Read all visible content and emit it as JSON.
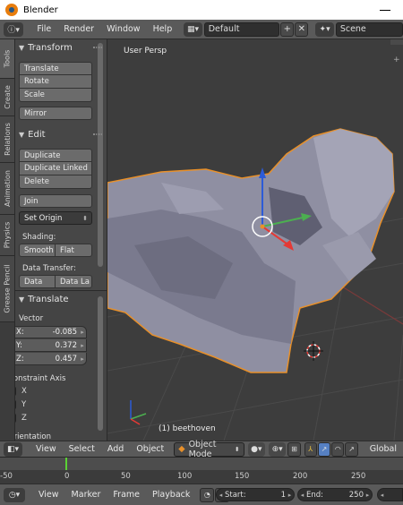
{
  "window": {
    "title": "Blender"
  },
  "info_header": {
    "menus": [
      "File",
      "Render",
      "Window",
      "Help"
    ],
    "screen_layout": "Default",
    "scene": "Scene"
  },
  "tool_tabs": [
    "Tools",
    "Create",
    "Relations",
    "Animation",
    "Physics",
    "Grease Pencil"
  ],
  "shelf": {
    "transform": {
      "title": "Transform",
      "buttons": [
        "Translate",
        "Rotate",
        "Scale"
      ],
      "mirror": "Mirror"
    },
    "edit": {
      "title": "Edit",
      "buttons": [
        "Duplicate",
        "Duplicate Linked",
        "Delete"
      ],
      "join": "Join",
      "set_origin": "Set Origin",
      "shading_label": "Shading:",
      "smooth": "Smooth",
      "flat": "Flat",
      "data_transfer_label": "Data Transfer:",
      "data": "Data",
      "data_layout": "Data La"
    },
    "operator": {
      "title": "Translate",
      "vector_label": "Vector",
      "x_label": "X:",
      "x_value": "-0.085",
      "y_label": "Y:",
      "y_value": "0.372",
      "z_label": "Z:",
      "z_value": "0.457",
      "constraint_label": "Constraint Axis",
      "axes": [
        "X",
        "Y",
        "Z"
      ],
      "orientation_label": "Orientation"
    }
  },
  "viewport": {
    "view_name": "User Persp",
    "object_label": "(1) beethoven"
  },
  "view3d_header": {
    "menus": [
      "View",
      "Select",
      "Add",
      "Object"
    ],
    "mode": "Object Mode",
    "orientation": "Global"
  },
  "timeline": {
    "ticks": [
      "-50",
      "0",
      "50",
      "100",
      "150",
      "200",
      "250"
    ],
    "current_frame": 1
  },
  "timeline_header": {
    "menus": [
      "View",
      "Marker",
      "Frame",
      "Playback"
    ],
    "start_label": "Start:",
    "start_value": "1",
    "end_label": "End:",
    "end_value": "250"
  },
  "colors": {
    "selection_outline": "#e8902a",
    "gizmo_x": "#e53935",
    "gizmo_y": "#4caf50",
    "gizmo_z": "#2c5bd7",
    "frame_cursor": "#5bd235"
  }
}
